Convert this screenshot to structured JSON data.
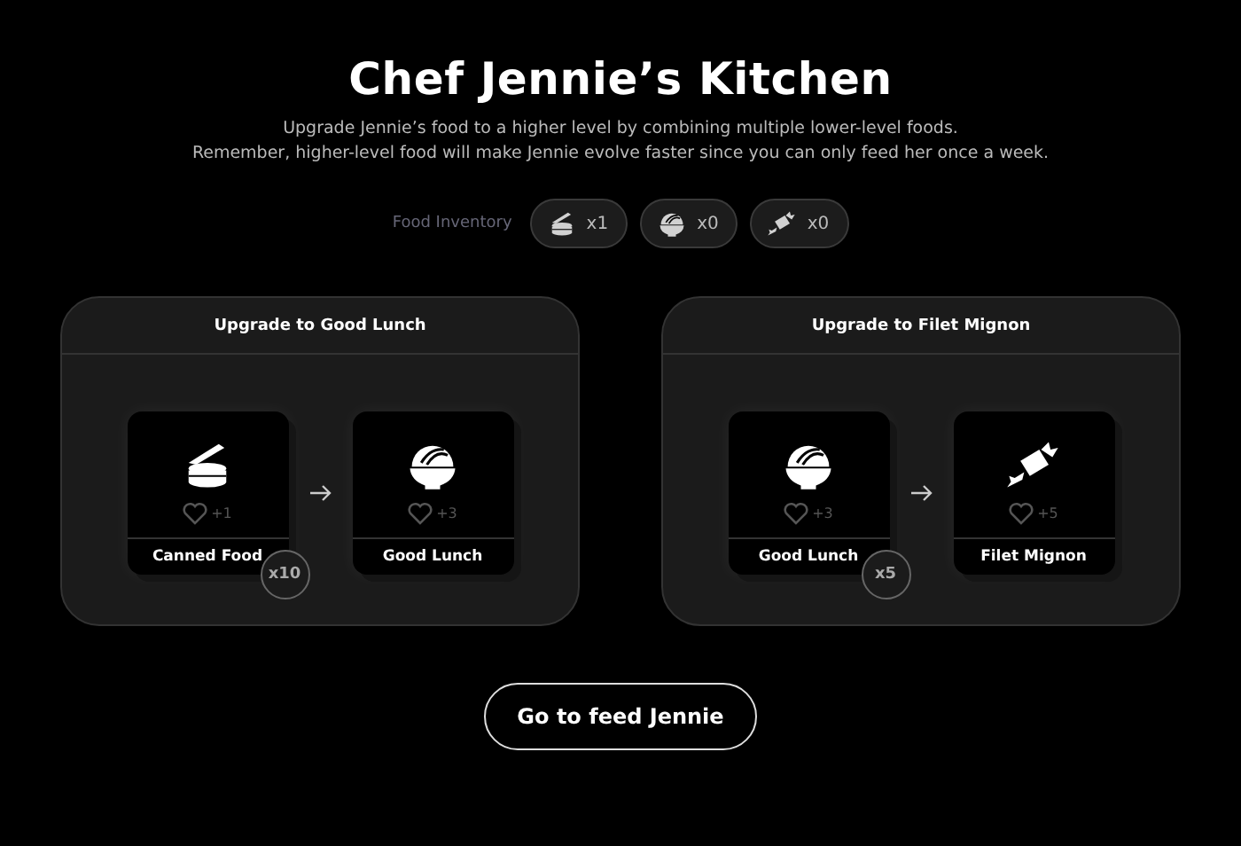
{
  "title": "Chef Jennie’s Kitchen",
  "subtitle": [
    "Upgrade Jennie’s food to a higher level by combining multiple lower-level foods.",
    "Remember, higher-level food will make Jennie evolve faster since you can only feed her once a week."
  ],
  "inventory": {
    "label": "Food Inventory",
    "items": [
      {
        "kind": "can",
        "count": "x1"
      },
      {
        "kind": "bowl",
        "count": "x0"
      },
      {
        "kind": "meat",
        "count": "x0"
      }
    ]
  },
  "upgrades": [
    {
      "title": "Upgrade to Good Lunch",
      "from": {
        "kind": "can",
        "hearts": "+1",
        "name": "Canned Food"
      },
      "cost": "x10",
      "to": {
        "kind": "bowl",
        "hearts": "+3",
        "name": "Good Lunch"
      }
    },
    {
      "title": "Upgrade to Filet Mignon",
      "from": {
        "kind": "bowl",
        "hearts": "+3",
        "name": "Good Lunch"
      },
      "cost": "x5",
      "to": {
        "kind": "meat",
        "hearts": "+5",
        "name": "Filet Mignon"
      }
    }
  ],
  "action": "Go to feed Jennie"
}
